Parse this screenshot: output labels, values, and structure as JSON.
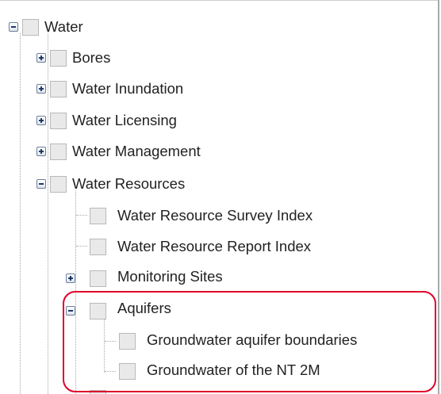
{
  "tree": {
    "root": {
      "label": "Water",
      "state": "expanded"
    },
    "level1": [
      {
        "label": "Bores",
        "state": "collapsed"
      },
      {
        "label": "Water Inundation",
        "state": "collapsed"
      },
      {
        "label": "Water Licensing",
        "state": "collapsed"
      },
      {
        "label": "Water Management",
        "state": "collapsed"
      },
      {
        "label": "Water Resources",
        "state": "expanded"
      }
    ],
    "water_resources_children": [
      {
        "label": "Water Resource Survey Index",
        "state": "leaf"
      },
      {
        "label": "Water Resource Report Index",
        "state": "leaf"
      },
      {
        "label": "Monitoring Sites",
        "state": "collapsed"
      },
      {
        "label": "Aquifers",
        "state": "expanded"
      }
    ],
    "aquifers_children": [
      {
        "label": "Groundwater aquifer boundaries",
        "state": "leaf"
      },
      {
        "label": "Groundwater of the NT 2M",
        "state": "leaf"
      }
    ]
  },
  "colors": {
    "highlight": "#e0002a",
    "checkbox_fill": "#e9e9e9",
    "connector": "#a7a7a7"
  }
}
